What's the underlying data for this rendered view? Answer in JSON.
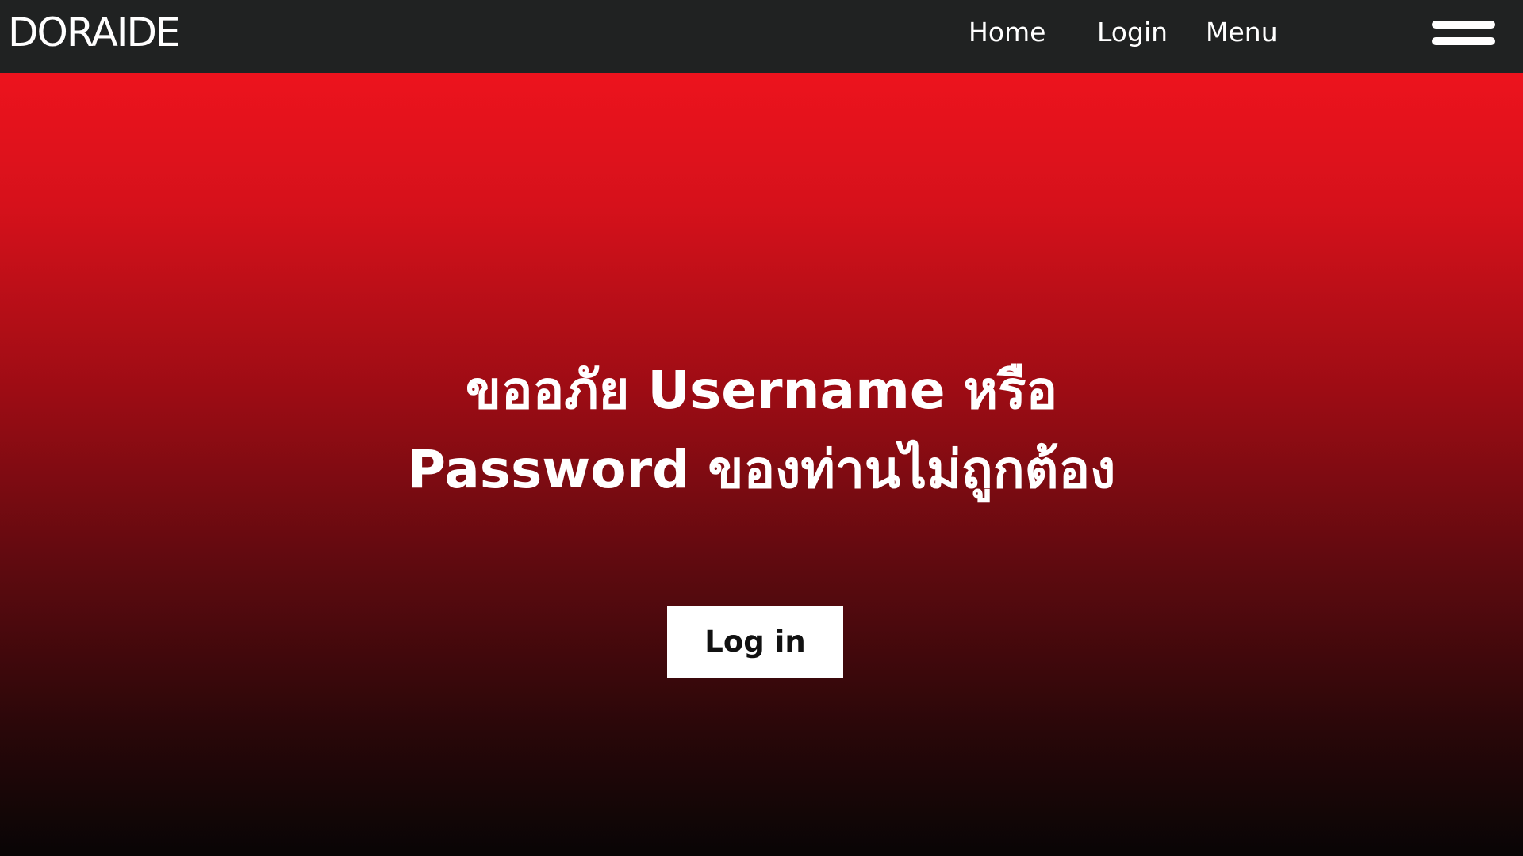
{
  "header": {
    "brand": "DORAIDE",
    "nav": {
      "home": "Home",
      "login": "Login",
      "menu": "Menu"
    },
    "menu_icon": "hamburger-menu-icon"
  },
  "main": {
    "message_line1": "ขออภัย Username หรือ",
    "message_line2": "Password ของท่านไม่ถูกต้อง",
    "login_button": "Log in"
  },
  "colors": {
    "navbar": "#202222",
    "gradient_top": "#ec131d",
    "gradient_bottom": "#080505",
    "text": "#ffffff",
    "button_bg": "#ffffff",
    "button_text": "#111111"
  }
}
